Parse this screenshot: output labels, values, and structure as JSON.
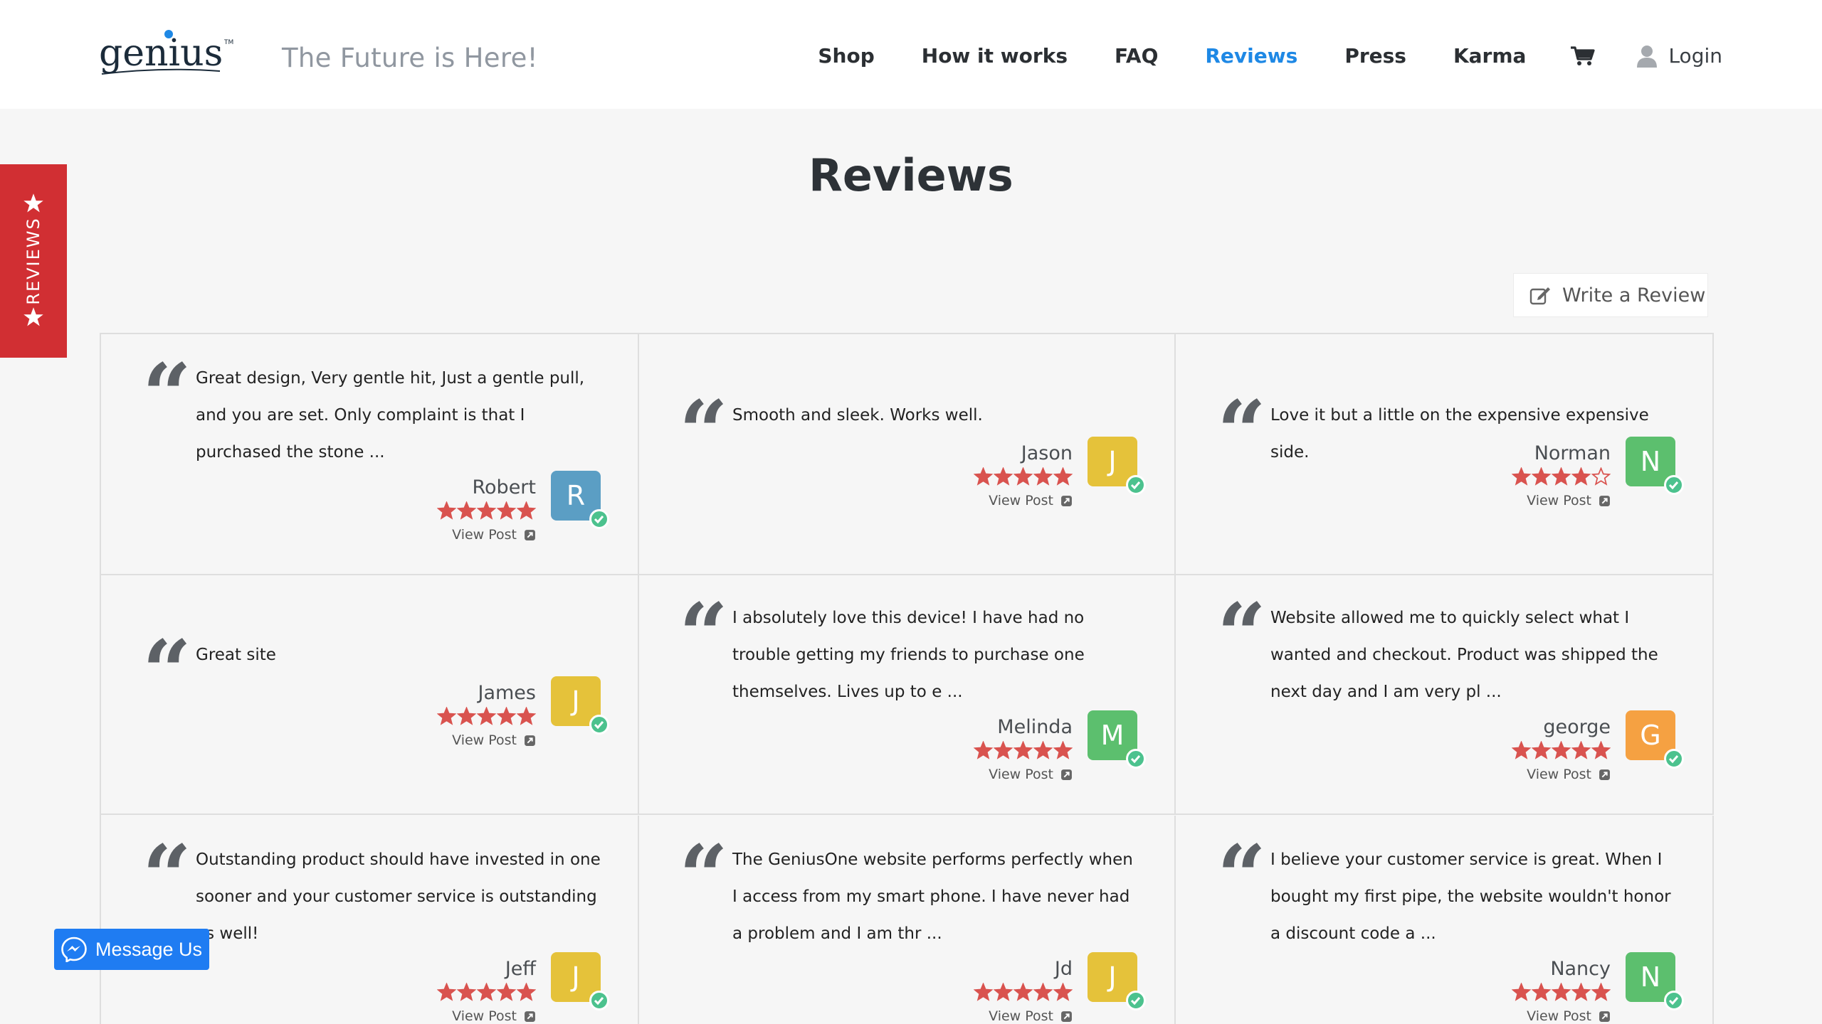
{
  "header": {
    "logo_text": "genius",
    "tagline": "The Future is Here!",
    "nav": [
      {
        "label": "Shop",
        "active": false
      },
      {
        "label": "How it works",
        "active": false
      },
      {
        "label": "FAQ",
        "active": false
      },
      {
        "label": "Reviews",
        "active": true
      },
      {
        "label": "Press",
        "active": false
      },
      {
        "label": "Karma",
        "active": false
      }
    ],
    "login_label": "Login"
  },
  "side_tab": {
    "label": "REVIEWS"
  },
  "page_title": "Reviews",
  "write_review_label": "Write a Review",
  "colors": {
    "accent": "#1e88e5",
    "star": "#d9534f",
    "side_tab": "#d12f33",
    "verified": "#4cc28e",
    "messenger": "#1f7cf2"
  },
  "reviews": [
    {
      "text": "Great design, Very gentle hit, Just a gentle pull, and you are set. Only complaint is that I purchased the stone ...",
      "author": "Robert",
      "initial": "R",
      "rating": 5,
      "avatar_color": "#5b9ec4",
      "view_post": "View Post"
    },
    {
      "text": "Smooth and sleek. Works well.",
      "author": "Jason",
      "initial": "J",
      "rating": 5,
      "avatar_color": "#e5c23a",
      "view_post": "View Post"
    },
    {
      "text": "Love it but a little on the expensive expensive side.",
      "author": "Norman",
      "initial": "N",
      "rating": 4,
      "avatar_color": "#5cbf6e",
      "view_post": "View Post"
    },
    {
      "text": "Great site",
      "author": "James",
      "initial": "J",
      "rating": 5,
      "avatar_color": "#e5c23a",
      "view_post": "View Post"
    },
    {
      "text": "I absolutely love this device! I have had no trouble getting my friends to purchase one themselves. Lives up to e ...",
      "author": "Melinda",
      "initial": "M",
      "rating": 5,
      "avatar_color": "#5cbf6e",
      "view_post": "View Post"
    },
    {
      "text": "Website allowed me to quickly select what I wanted and checkout. Product was shipped the next day and I am very pl ...",
      "author": "george",
      "initial": "G",
      "rating": 5,
      "avatar_color": "#f5a142",
      "view_post": "View Post"
    },
    {
      "text": "Outstanding product should have invested in one sooner and your customer service is outstanding as well!",
      "author": "Jeff",
      "initial": "J",
      "rating": 5,
      "avatar_color": "#e5c23a",
      "view_post": "View Post"
    },
    {
      "text": "The GeniusOne website performs perfectly when I access from my smart phone. I have never had a problem and I am thr ...",
      "author": "Jd",
      "initial": "J",
      "rating": 5,
      "avatar_color": "#e5c23a",
      "view_post": "View Post"
    },
    {
      "text": "I believe your customer service is great. When I bought my first pipe, the website wouldn't honor a discount code a ...",
      "author": "Nancy",
      "initial": "N",
      "rating": 5,
      "avatar_color": "#5cbf6e",
      "view_post": "View Post"
    }
  ],
  "messenger_label": "Message Us"
}
